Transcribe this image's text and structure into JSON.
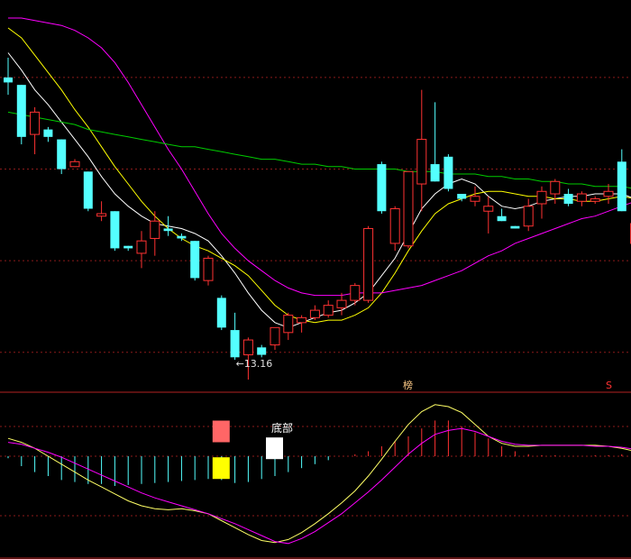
{
  "chart_data": [
    {
      "type": "candlestick",
      "panel": "price",
      "y_range": [
        10.0,
        25.0
      ],
      "grid_levels": [
        11.5,
        15.2,
        18.9,
        22.6
      ],
      "candles": [
        {
          "o": 22.4,
          "h": 23.4,
          "l": 21.9,
          "c": 22.6,
          "up": false
        },
        {
          "o": 22.3,
          "h": 22.3,
          "l": 19.9,
          "c": 20.2,
          "up": false
        },
        {
          "o": 20.3,
          "h": 21.4,
          "l": 19.5,
          "c": 21.2,
          "up": true
        },
        {
          "o": 20.5,
          "h": 20.6,
          "l": 20.0,
          "c": 20.2,
          "up": false
        },
        {
          "o": 20.1,
          "h": 20.1,
          "l": 18.7,
          "c": 18.9,
          "up": false
        },
        {
          "o": 19.0,
          "h": 19.3,
          "l": 19.0,
          "c": 19.2,
          "up": true
        },
        {
          "o": 18.8,
          "h": 18.8,
          "l": 17.2,
          "c": 17.3,
          "up": false
        },
        {
          "o": 17.1,
          "h": 17.6,
          "l": 16.8,
          "c": 17.0,
          "up": true
        },
        {
          "o": 17.2,
          "h": 17.2,
          "l": 15.6,
          "c": 15.7,
          "up": false
        },
        {
          "o": 15.8,
          "h": 15.8,
          "l": 15.6,
          "c": 15.7,
          "up": false
        },
        {
          "o": 15.5,
          "h": 16.4,
          "l": 14.9,
          "c": 16.0,
          "up": true
        },
        {
          "o": 16.1,
          "h": 17.2,
          "l": 15.4,
          "c": 16.8,
          "up": true
        },
        {
          "o": 16.5,
          "h": 17.0,
          "l": 16.2,
          "c": 16.4,
          "up": false
        },
        {
          "o": 16.2,
          "h": 16.3,
          "l": 16.0,
          "c": 16.1,
          "up": false
        },
        {
          "o": 16.0,
          "h": 16.0,
          "l": 14.4,
          "c": 14.5,
          "up": false
        },
        {
          "o": 14.4,
          "h": 15.4,
          "l": 14.2,
          "c": 15.3,
          "up": true
        },
        {
          "o": 13.7,
          "h": 13.8,
          "l": 12.4,
          "c": 12.5,
          "up": false
        },
        {
          "o": 12.4,
          "h": 13.1,
          "l": 11.2,
          "c": 11.3,
          "up": false
        },
        {
          "o": 11.4,
          "h": 12.1,
          "l": 10.4,
          "c": 12.0,
          "up": true
        },
        {
          "o": 11.7,
          "h": 11.8,
          "l": 11.3,
          "c": 11.4,
          "up": false
        },
        {
          "o": 11.8,
          "h": 12.5,
          "l": 11.6,
          "c": 12.5,
          "up": true
        },
        {
          "o": 12.3,
          "h": 13.1,
          "l": 12.0,
          "c": 13.0,
          "up": true
        },
        {
          "o": 12.7,
          "h": 13.0,
          "l": 12.3,
          "c": 12.9,
          "up": true
        },
        {
          "o": 12.9,
          "h": 13.4,
          "l": 12.8,
          "c": 13.2,
          "up": true
        },
        {
          "o": 13.0,
          "h": 13.6,
          "l": 12.9,
          "c": 13.4,
          "up": true
        },
        {
          "o": 13.3,
          "h": 13.9,
          "l": 13.0,
          "c": 13.6,
          "up": true
        },
        {
          "o": 13.6,
          "h": 14.3,
          "l": 13.4,
          "c": 14.2,
          "up": true
        },
        {
          "o": 13.6,
          "h": 16.6,
          "l": 13.5,
          "c": 16.5,
          "up": true
        },
        {
          "o": 19.1,
          "h": 19.2,
          "l": 17.1,
          "c": 17.2,
          "up": false
        },
        {
          "o": 15.9,
          "h": 17.4,
          "l": 15.6,
          "c": 17.3,
          "up": true
        },
        {
          "o": 15.8,
          "h": 18.8,
          "l": 15.7,
          "c": 18.8,
          "up": true
        },
        {
          "o": 18.3,
          "h": 22.1,
          "l": 17.2,
          "c": 20.1,
          "up": true
        },
        {
          "o": 19.1,
          "h": 21.6,
          "l": 18.4,
          "c": 18.4,
          "up": false
        },
        {
          "o": 19.4,
          "h": 19.5,
          "l": 18.0,
          "c": 18.1,
          "up": false
        },
        {
          "o": 17.9,
          "h": 17.9,
          "l": 17.6,
          "c": 17.7,
          "up": false
        },
        {
          "o": 17.8,
          "h": 18.2,
          "l": 17.4,
          "c": 17.6,
          "up": true
        },
        {
          "o": 17.2,
          "h": 17.8,
          "l": 16.3,
          "c": 17.4,
          "up": true
        },
        {
          "o": 17.0,
          "h": 17.3,
          "l": 16.8,
          "c": 16.8,
          "up": false
        },
        {
          "o": 16.6,
          "h": 16.6,
          "l": 16.5,
          "c": 16.5,
          "up": false
        },
        {
          "o": 16.6,
          "h": 17.7,
          "l": 16.4,
          "c": 17.4,
          "up": true
        },
        {
          "o": 17.5,
          "h": 18.2,
          "l": 16.9,
          "c": 18.0,
          "up": true
        },
        {
          "o": 17.9,
          "h": 18.5,
          "l": 17.5,
          "c": 18.4,
          "up": true
        },
        {
          "o": 17.9,
          "h": 18.1,
          "l": 17.4,
          "c": 17.5,
          "up": false
        },
        {
          "o": 17.6,
          "h": 18.0,
          "l": 17.4,
          "c": 17.9,
          "up": true
        },
        {
          "o": 17.6,
          "h": 17.8,
          "l": 17.5,
          "c": 17.7,
          "up": true
        },
        {
          "o": 17.8,
          "h": 18.3,
          "l": 17.5,
          "c": 18.0,
          "up": true
        },
        {
          "o": 19.2,
          "h": 19.7,
          "l": 17.2,
          "c": 17.2,
          "up": false
        },
        {
          "o": 16.7,
          "h": 16.9,
          "l": 15.8,
          "c": 15.9,
          "up": true
        }
      ],
      "moving_averages": [
        {
          "color": "#ffffff",
          "values": [
            23.6,
            22.9,
            22.1,
            21.5,
            20.8,
            20.1,
            19.4,
            18.6,
            17.9,
            17.4,
            17.0,
            16.7,
            16.6,
            16.5,
            16.3,
            16.0,
            15.4,
            14.7,
            13.9,
            13.2,
            12.7,
            12.5,
            12.7,
            12.9,
            13.1,
            13.2,
            13.5,
            13.9,
            14.6,
            15.3,
            16.3,
            17.3,
            17.9,
            18.3,
            18.5,
            18.3,
            17.8,
            17.4,
            17.3,
            17.4,
            17.6,
            17.7,
            17.8,
            17.8,
            17.9,
            17.9,
            17.9,
            17.7
          ]
        },
        {
          "color": "#ffff00",
          "values": [
            24.6,
            24.2,
            23.5,
            22.8,
            22.1,
            21.3,
            20.6,
            19.8,
            19.0,
            18.3,
            17.6,
            17.0,
            16.5,
            16.1,
            15.8,
            15.6,
            15.3,
            15.0,
            14.6,
            14.0,
            13.4,
            13.0,
            12.8,
            12.7,
            12.8,
            12.8,
            13.0,
            13.3,
            13.9,
            14.7,
            15.6,
            16.4,
            17.1,
            17.5,
            17.7,
            17.9,
            18.0,
            18.0,
            17.9,
            17.8,
            17.8,
            17.7,
            17.7,
            17.6,
            17.6,
            17.7,
            17.8,
            17.7
          ]
        },
        {
          "color": "#ff00ff",
          "values": [
            25.0,
            25.0,
            24.9,
            24.8,
            24.7,
            24.5,
            24.2,
            23.8,
            23.2,
            22.4,
            21.5,
            20.6,
            19.7,
            18.9,
            18.0,
            17.1,
            16.3,
            15.7,
            15.2,
            14.8,
            14.4,
            14.1,
            13.9,
            13.8,
            13.8,
            13.8,
            13.9,
            13.9,
            13.9,
            14.0,
            14.1,
            14.2,
            14.4,
            14.6,
            14.8,
            15.1,
            15.4,
            15.6,
            15.9,
            16.1,
            16.3,
            16.5,
            16.7,
            16.9,
            17.0,
            17.2,
            17.4,
            17.6
          ]
        },
        {
          "color": "#00cc00",
          "values": [
            21.2,
            21.1,
            21.0,
            20.9,
            20.8,
            20.7,
            20.5,
            20.4,
            20.3,
            20.2,
            20.1,
            20.0,
            19.9,
            19.8,
            19.8,
            19.7,
            19.6,
            19.5,
            19.4,
            19.3,
            19.3,
            19.2,
            19.1,
            19.1,
            19.0,
            19.0,
            18.9,
            18.9,
            18.9,
            18.9,
            18.8,
            18.8,
            18.8,
            18.7,
            18.7,
            18.7,
            18.6,
            18.6,
            18.5,
            18.5,
            18.4,
            18.4,
            18.3,
            18.3,
            18.2,
            18.2,
            18.2,
            18.1
          ]
        }
      ],
      "annotations": [
        {
          "text": "←13.16",
          "candle_index": 17
        },
        {
          "text": "榜",
          "candle_index": 30
        },
        {
          "text": "S",
          "candle_index": 45
        }
      ],
      "colors": {
        "up": "#ff3232",
        "down": "#54ffff",
        "grid": "#8b1a1a"
      }
    },
    {
      "type": "macd",
      "panel": "indicator",
      "y_range": [
        -1.0,
        0.6
      ],
      "histogram": [
        -0.02,
        -0.1,
        -0.16,
        -0.2,
        -0.24,
        -0.26,
        -0.28,
        -0.28,
        -0.3,
        -0.29,
        -0.28,
        -0.27,
        -0.26,
        -0.25,
        -0.24,
        -0.23,
        -0.24,
        -0.27,
        -0.26,
        -0.23,
        -0.2,
        -0.16,
        -0.12,
        -0.08,
        -0.04,
        0.0,
        0.02,
        0.05,
        0.1,
        0.15,
        0.2,
        0.28,
        0.36,
        0.36,
        0.3,
        0.24,
        0.18,
        0.1,
        0.05,
        0.02,
        0.01,
        0.01,
        0.0,
        0.0,
        0.01,
        0.01,
        0.02,
        0.03
      ],
      "dif": [
        0.18,
        0.14,
        0.08,
        0.0,
        -0.08,
        -0.16,
        -0.24,
        -0.31,
        -0.38,
        -0.45,
        -0.5,
        -0.53,
        -0.54,
        -0.53,
        -0.55,
        -0.58,
        -0.65,
        -0.72,
        -0.79,
        -0.85,
        -0.87,
        -0.84,
        -0.77,
        -0.68,
        -0.58,
        -0.47,
        -0.35,
        -0.2,
        -0.03,
        0.15,
        0.32,
        0.45,
        0.52,
        0.5,
        0.44,
        0.32,
        0.2,
        0.13,
        0.1,
        0.1,
        0.11,
        0.11,
        0.11,
        0.11,
        0.11,
        0.1,
        0.08,
        0.05
      ],
      "dea": [
        0.14,
        0.12,
        0.08,
        0.04,
        -0.01,
        -0.07,
        -0.13,
        -0.19,
        -0.25,
        -0.31,
        -0.37,
        -0.42,
        -0.46,
        -0.5,
        -0.54,
        -0.58,
        -0.63,
        -0.68,
        -0.74,
        -0.8,
        -0.86,
        -0.88,
        -0.83,
        -0.76,
        -0.67,
        -0.58,
        -0.47,
        -0.36,
        -0.24,
        -0.11,
        0.02,
        0.13,
        0.22,
        0.26,
        0.28,
        0.25,
        0.2,
        0.15,
        0.12,
        0.11,
        0.11,
        0.11,
        0.11,
        0.11,
        0.1,
        0.1,
        0.09,
        0.07
      ],
      "markers": [
        {
          "label": "",
          "color": "#ff6666",
          "candle_index": 16,
          "level": 0.25
        },
        {
          "label": "",
          "color": "#ffff00",
          "candle_index": 16,
          "level": -0.12
        },
        {
          "label": "底部",
          "color": "#ffffff",
          "candle_index": 20,
          "level": 0.08
        }
      ],
      "colors": {
        "hist_pos": "#ff3232",
        "hist_neg": "#54ffff",
        "dif": "#ffff66",
        "dea": "#ff00ff",
        "grid": "#8b1a1a"
      }
    }
  ]
}
